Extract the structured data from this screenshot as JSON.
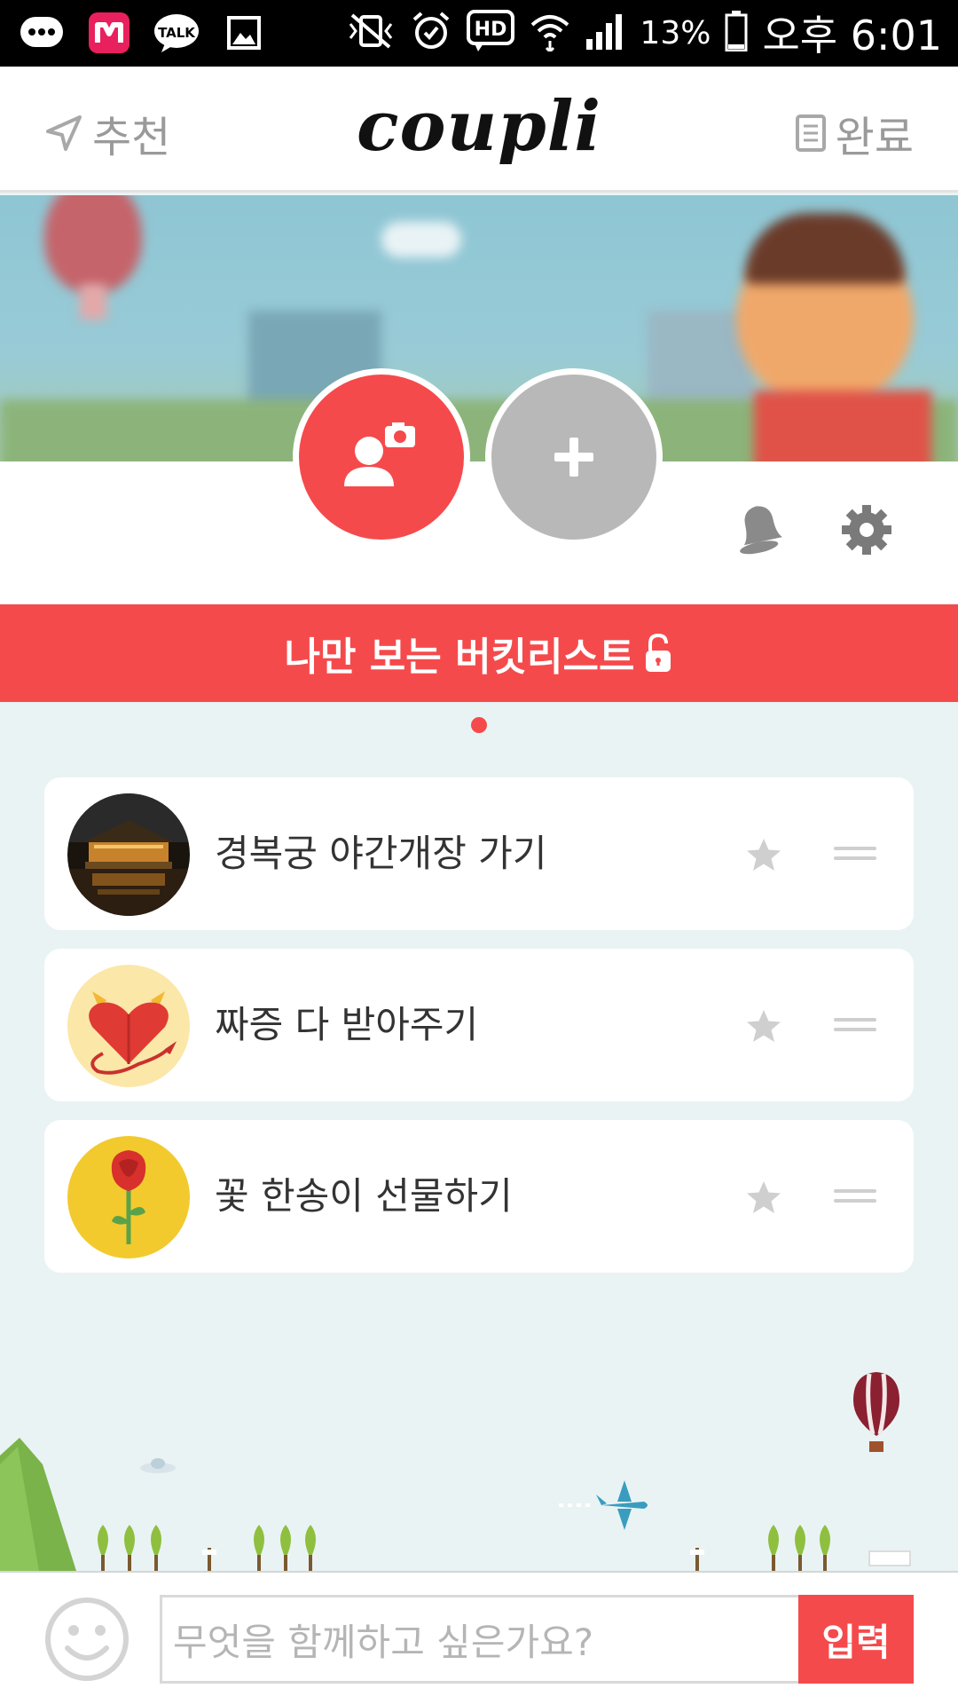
{
  "status_bar": {
    "left_icons": [
      "more-icon",
      "mnet-app-icon",
      "kakaotalk-icon",
      "image-icon"
    ],
    "right_icons": [
      "vibrate-mute-icon",
      "alarm-icon",
      "hd-icon",
      "wifi-icon",
      "signal-icon",
      "battery-icon"
    ],
    "hd": "HD",
    "battery": "13%",
    "time": "오후 6:01"
  },
  "header": {
    "left_label": "추천",
    "logo": "coupli",
    "right_label": "완료"
  },
  "profile": {
    "add_photo_icon": "person-camera-icon",
    "add_partner_icon": "plus-icon",
    "notification_icon": "bell-icon",
    "settings_icon": "gear-icon"
  },
  "bucket_bar": {
    "title": "나만 보는 버킷리스트",
    "icon": "unlocked-padlock-icon"
  },
  "bucket_items": [
    {
      "label": "경복궁 야간개장 가기",
      "thumb": "palace-night-thumbnail"
    },
    {
      "label": "짜증 다 받아주기",
      "thumb": "devil-heart-thumbnail"
    },
    {
      "label": "꽃 한송이 선물하기",
      "thumb": "rose-thumbnail"
    }
  ],
  "input_bar": {
    "placeholder": "무엇을 함께하고 싶은가요?",
    "submit_label": "입력"
  },
  "colors": {
    "accent": "#f54a4c",
    "gray_circle": "#b8b8b8",
    "background": "#e9f3f4"
  }
}
